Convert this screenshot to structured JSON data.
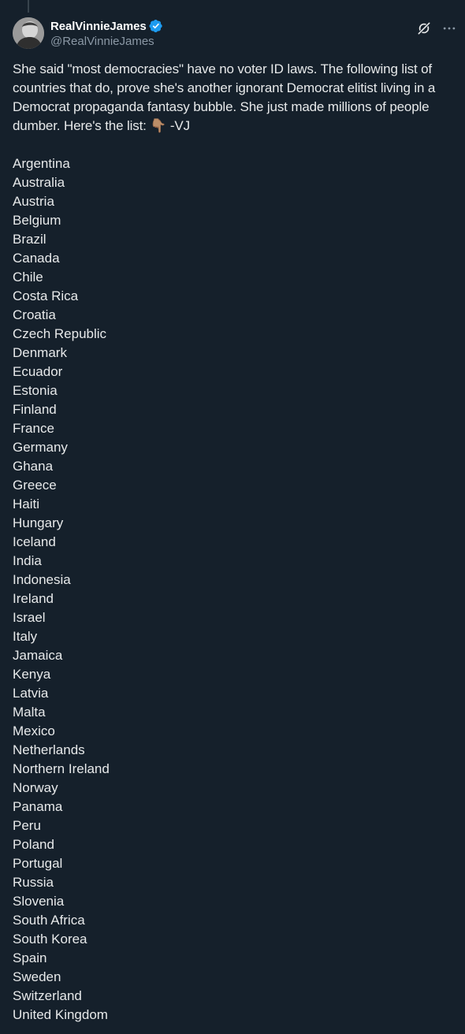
{
  "tweet": {
    "display_name": "RealVinnieJames",
    "handle": "@RealVinnieJames",
    "verified": true,
    "verified_color": "#1d9bf0",
    "intro_text": "She said \"most democracies\" have no voter ID laws. The following list of countries that do, prove she's another ignorant Democrat elitist living in a Democrat propaganda fantasy bubble. She just made millions of people dumber. Here's the list: 👇🏽 -VJ",
    "countries": [
      "Argentina",
      "Australia",
      "Austria",
      "Belgium",
      "Brazil",
      "Canada",
      "Chile",
      "Costa Rica",
      "Croatia",
      "Czech Republic",
      "Denmark",
      "Ecuador",
      "Estonia",
      "Finland",
      "France",
      "Germany",
      "Ghana",
      "Greece",
      "Haiti",
      "Hungary",
      "Iceland",
      "India",
      "Indonesia",
      "Ireland",
      "Israel",
      "Italy",
      "Jamaica",
      "Kenya",
      "Latvia",
      "Malta",
      "Mexico",
      "Netherlands",
      "Northern Ireland",
      "Norway",
      "Panama",
      "Peru",
      "Poland",
      "Portugal",
      "Russia",
      "Slovenia",
      "South Africa",
      "South Korea",
      "Spain",
      "Sweden",
      "Switzerland",
      "United Kingdom"
    ]
  },
  "icons": {
    "verified": "verified-badge-icon",
    "grok": "grok-icon",
    "more": "more-options-icon"
  },
  "colors": {
    "background": "#15202b",
    "text_primary": "#e7e9ea",
    "text_secondary": "#8b98a5"
  }
}
